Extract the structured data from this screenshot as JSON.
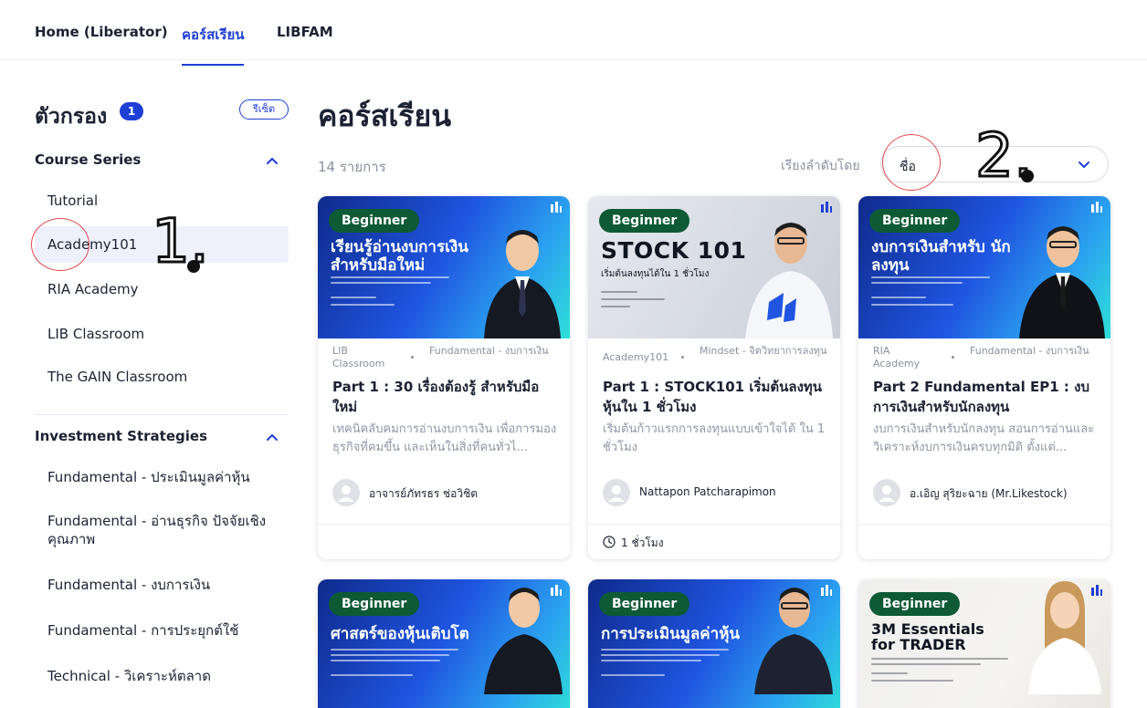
{
  "topnav": {
    "items": [
      {
        "label": "Home (Liberator)",
        "active": false
      },
      {
        "label": "คอร์สเรียน",
        "active": true
      },
      {
        "label": "LIBFAM",
        "active": false
      }
    ]
  },
  "sidebar": {
    "filter_title": "ตัวกรอง",
    "filter_count": "1",
    "reset_label": "รีเซ็ต",
    "course_series": {
      "heading": "Course Series",
      "items": [
        {
          "label": "Tutorial",
          "selected": false
        },
        {
          "label": "Academy101",
          "selected": true
        },
        {
          "label": "RIA Academy",
          "selected": false
        },
        {
          "label": "LIB Classroom",
          "selected": false
        },
        {
          "label": "The GAIN Classroom",
          "selected": false
        }
      ]
    },
    "investment_strategies": {
      "heading": "Investment Strategies",
      "items": [
        {
          "label": "Fundamental - ประเมินมูลค่าหุ้น"
        },
        {
          "label": "Fundamental - อ่านธุรกิจ ปัจจัยเชิงคุณภาพ"
        },
        {
          "label": "Fundamental - งบการเงิน"
        },
        {
          "label": "Fundamental - การประยุกต์ใช้"
        },
        {
          "label": "Technical - วิเคราะห์ตลาด"
        }
      ]
    }
  },
  "main": {
    "title": "คอร์สเรียน",
    "count": "14 รายการ",
    "sort_label": "เรียงลำดับโดย",
    "sort_value": "ชื่อ"
  },
  "cards": [
    {
      "level": "Beginner",
      "thumb_title": "เรียนรู้อ่านงบการเงิน สำหรับมือใหม่",
      "category": "LIB Classroom",
      "tag": "Fundamental - งบการเงิน",
      "title": "Part 1 : 30 เรื่องต้องรู้ สำหรับมือใหม่",
      "description": "เทคนิคลับคมการอ่านงบการเงิน เพื่อการมองธุรกิจที่คมขึ้น และเห็นในสิ่งที่คนทั่วไ...",
      "author": "อาจารย์ภัทรธร ช่อวิชิต"
    },
    {
      "level": "Beginner",
      "thumb_title": "STOCK 101",
      "thumb_sub": "เริ่มต้นลงทุนได้ใน 1 ชั่วโมง",
      "category": "Academy101",
      "tag": "Mindset - จิตวิทยาการลงทุน",
      "title": "Part 1 : STOCK101 เริ่มต้นลงทุนหุ้นใน 1 ชั่วโมง",
      "description": "เริ่มต้นก้าวแรกการลงทุนแบบเข้าใจได้ ใน 1 ชั่วโมง",
      "author": "Nattapon Patcharapimon",
      "duration": "1 ชั่วโมง"
    },
    {
      "level": "Beginner",
      "thumb_title": "งบการเงินสำหรับ นักลงทุน",
      "category": "RIA Academy",
      "tag": "Fundamental - งบการเงิน",
      "title": "Part 2 Fundamental EP1 : งบการเงินสำหรับนักลงทุน",
      "description": "งบการเงินสำหรับนักลงทุน สอนการอ่านและวิเคราะห์งบการเงินครบทุกมิติ ตั้งแต่...",
      "author": "อ.เอิญ สุริยะฉาย (Mr.Likestock)"
    },
    {
      "level": "Beginner",
      "thumb_title": "ศาสตร์ของหุ้นเติบโต"
    },
    {
      "level": "Beginner",
      "thumb_title": "การประเมินมูลค่าหุ้น"
    },
    {
      "level": "Beginner",
      "thumb_title": "3M Essentials for TRADER"
    }
  ],
  "annotations": {
    "num1": "1.",
    "num2": "2.",
    "color": "#e24a4a"
  },
  "colors": {
    "accent": "#1f3fd6",
    "badge_green": "#0d5a35",
    "text": "#1b2233",
    "muted": "#8a90a0"
  }
}
